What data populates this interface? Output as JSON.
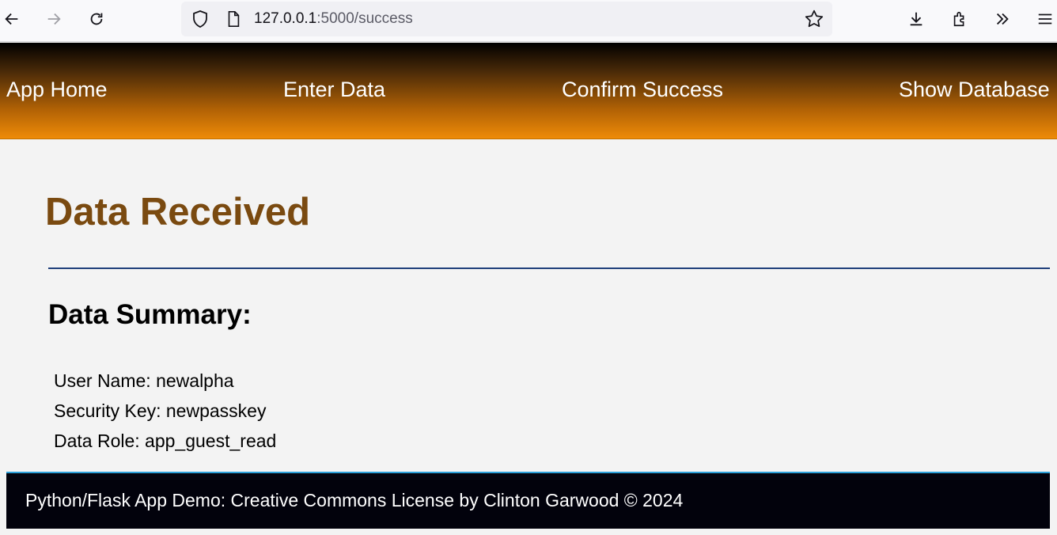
{
  "browser": {
    "url_host": "127.0.0.1",
    "url_rest": ":5000/success",
    "icons": [
      "back-icon",
      "forward-icon",
      "reload-icon",
      "shield-icon",
      "page-icon",
      "star-icon",
      "download-icon",
      "extensions-icon",
      "overflow-icon",
      "menu-icon"
    ]
  },
  "nav": {
    "items": [
      {
        "label": "App Home"
      },
      {
        "label": "Enter Data"
      },
      {
        "label": "Confirm Success"
      },
      {
        "label": "Show Database"
      }
    ]
  },
  "main": {
    "title": "Data Received",
    "summary_title": "Data Summary:",
    "rows": [
      {
        "text": "User Name: newalpha"
      },
      {
        "text": "Security Key: newpasskey"
      },
      {
        "text": "Data Role: app_guest_read"
      }
    ]
  },
  "footer": {
    "text": "Python/Flask App Demo: Creative Commons License by Clinton Garwood © 2024"
  },
  "colors": {
    "nav_gradient_top": "#000000",
    "nav_gradient_bottom": "#ee8b08",
    "title": "#7a4a10",
    "rule": "#1f3f7a",
    "footer_bg": "#02020c",
    "footer_border": "#2a9fd8"
  }
}
